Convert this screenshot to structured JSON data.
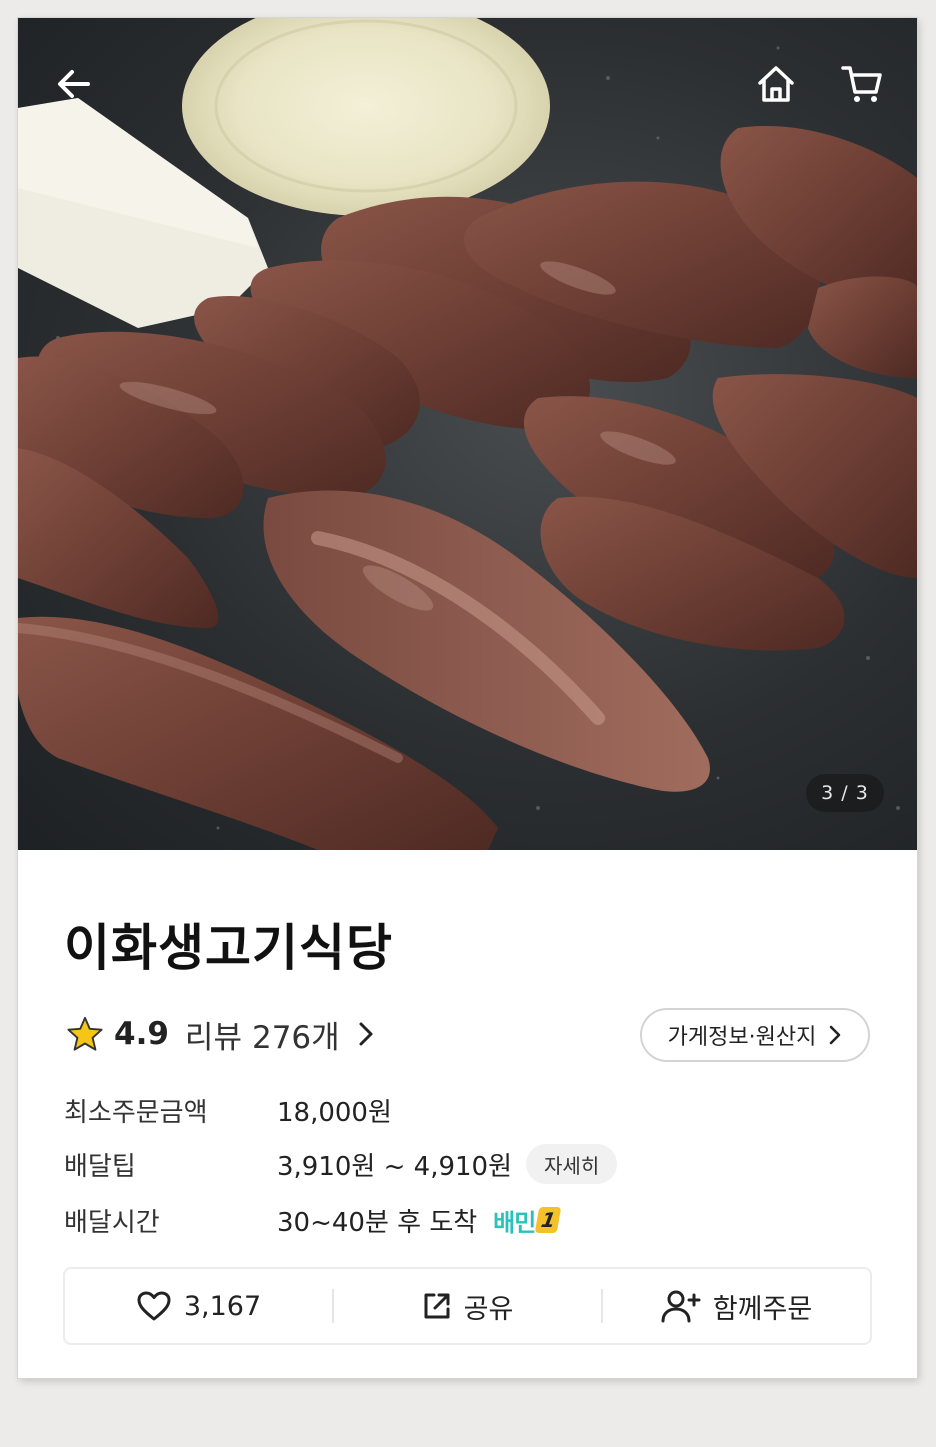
{
  "hero": {
    "pager_text": "3 / 3"
  },
  "store": {
    "name": "이화생고기식당",
    "rating": "4.9",
    "review_label": "리뷰",
    "review_count": "276개",
    "info_button_label": "가게정보·원산지"
  },
  "details": {
    "min_order_label": "최소주문금액",
    "min_order_value": "18,000원",
    "delivery_tip_label": "배달팁",
    "delivery_tip_value": "3,910원 ~ 4,910원",
    "delivery_tip_detail": "자세히",
    "delivery_time_label": "배달시간",
    "delivery_time_value": "30~40분 후 도착",
    "badge_text": "배민",
    "badge_number": "1"
  },
  "actions": {
    "like_count": "3,167",
    "share_label": "공유",
    "group_order_label": "함께주문"
  },
  "colors": {
    "star": "#f5c518",
    "badge_teal": "#2ac1bc",
    "badge_yellow": "#f3c12a"
  },
  "icons": [
    "back-arrow-icon",
    "home-icon",
    "cart-icon",
    "star-icon",
    "chevron-right-icon",
    "heart-icon",
    "share-icon",
    "add-person-icon"
  ]
}
